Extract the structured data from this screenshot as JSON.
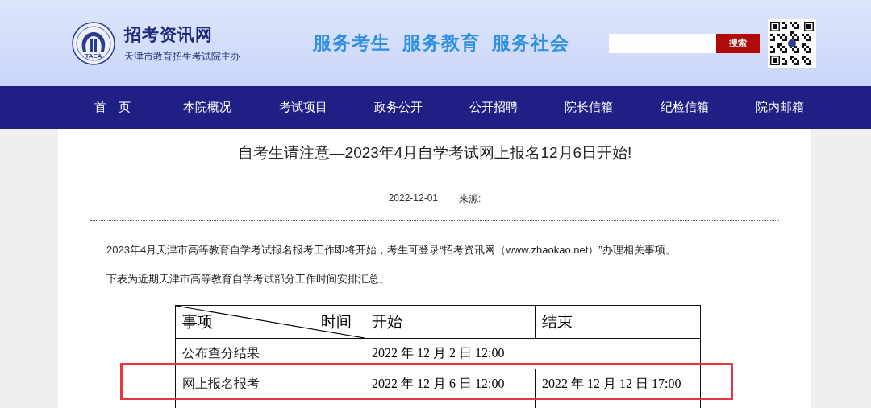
{
  "header": {
    "site_name": "招考资讯网",
    "site_owner": "天津市教育招生考试院主办",
    "logo_text": "TAEA",
    "slogan": "服务考生  服务教育  服务社会",
    "search": {
      "button": "搜索"
    }
  },
  "nav": [
    {
      "label": "首　页"
    },
    {
      "label": "本院概况"
    },
    {
      "label": "考试项目"
    },
    {
      "label": "政务公开"
    },
    {
      "label": "公开招聘"
    },
    {
      "label": "院长信箱"
    },
    {
      "label": "纪检信箱"
    },
    {
      "label": "院内邮箱"
    }
  ],
  "article": {
    "title": "自考生请注意—2023年4月自学考试网上报名12月6日开始!",
    "date": "2022-12-01",
    "source_label": "来源:",
    "paragraphs": [
      "2023年4月天津市高等教育自学考试报名报考工作即将开始，考生可登录“招考资讯网（www.zhaokao.net）”办理相关事项。",
      "下表为近期天津市高等教育自学考试部分工作时间安排汇总。"
    ],
    "table": {
      "corner_left": "事项",
      "corner_right": "时间",
      "columns": [
        "开始",
        "结束"
      ],
      "rows": [
        {
          "item": "公布查分结果",
          "start": "2022 年 12 月 2 日 12:00"
        },
        {
          "item": "网上报名报考",
          "start": "2022 年 12 月 6 日 12:00",
          "end": "2022 年 12 月 12 日 17:00",
          "highlighted": true
        }
      ]
    }
  }
}
